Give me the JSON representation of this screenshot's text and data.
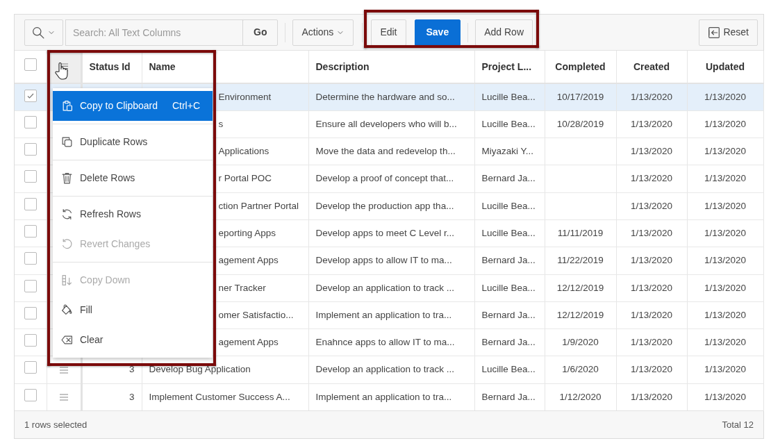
{
  "select_all": {
    "checked": false
  },
  "toolbar": {
    "search_placeholder": "Search: All Text Columns",
    "go": "Go",
    "actions": "Actions",
    "edit": "Edit",
    "save": "Save",
    "add_row": "Add Row",
    "reset": "Reset"
  },
  "table": {
    "columns": [
      "Status Id",
      "Name",
      "Description",
      "Project L...",
      "Completed",
      "Created",
      "Updated"
    ],
    "rows": [
      {
        "selected": true,
        "under_menu": true,
        "name": "Environment",
        "description": "Determine the hardware and so...",
        "project_lead": "Lucille Bea...",
        "completed": "10/17/2019",
        "created": "1/13/2020",
        "updated": "1/13/2020"
      },
      {
        "selected": false,
        "under_menu": true,
        "name": "s",
        "description": "Ensure all developers who will b...",
        "project_lead": "Lucille Bea...",
        "completed": "10/28/2019",
        "created": "1/13/2020",
        "updated": "1/13/2020"
      },
      {
        "selected": false,
        "under_menu": true,
        "name": "Applications",
        "description": "Move the data and redevelop th...",
        "project_lead": "Miyazaki Y...",
        "created": "1/13/2020",
        "updated": "1/13/2020"
      },
      {
        "selected": false,
        "under_menu": true,
        "name": "r Portal POC",
        "description": "Develop a proof of concept that...",
        "project_lead": "Bernard Ja...",
        "created": "1/13/2020",
        "updated": "1/13/2020"
      },
      {
        "selected": false,
        "under_menu": true,
        "name": "ction Partner Portal",
        "description": "Develop the production app tha...",
        "project_lead": "Lucille Bea...",
        "created": "1/13/2020",
        "updated": "1/13/2020"
      },
      {
        "selected": false,
        "under_menu": true,
        "name": "eporting Apps",
        "description": "Develop apps to meet C Level r...",
        "project_lead": "Lucille Bea...",
        "completed": "11/11/2019",
        "created": "1/13/2020",
        "updated": "1/13/2020"
      },
      {
        "selected": false,
        "under_menu": true,
        "name": "agement Apps",
        "description": "Develop apps to allow IT to ma...",
        "project_lead": "Bernard Ja...",
        "completed": "11/22/2019",
        "created": "1/13/2020",
        "updated": "1/13/2020"
      },
      {
        "selected": false,
        "under_menu": true,
        "name": "ner Tracker",
        "description": "Develop an application to track ...",
        "project_lead": "Lucille Bea...",
        "completed": "12/12/2019",
        "created": "1/13/2020",
        "updated": "1/13/2020"
      },
      {
        "selected": false,
        "under_menu": true,
        "name": "omer Satisfactio...",
        "description": "Implement an application to tra...",
        "project_lead": "Bernard Ja...",
        "completed": "12/12/2019",
        "created": "1/13/2020",
        "updated": "1/13/2020"
      },
      {
        "selected": false,
        "under_menu": true,
        "name": "agement Apps",
        "description": "Enahnce apps to allow IT to ma...",
        "project_lead": "Bernard Ja...",
        "completed": "1/9/2020",
        "created": "1/13/2020",
        "updated": "1/13/2020"
      },
      {
        "selected": false,
        "under_menu": false,
        "status_id": "3",
        "name": "Develop Bug Application",
        "description": "Develop an application to track ...",
        "project_lead": "Lucille Bea...",
        "completed": "1/6/2020",
        "created": "1/13/2020",
        "updated": "1/13/2020"
      },
      {
        "selected": false,
        "under_menu": false,
        "status_id": "3",
        "name": "Implement Customer Success A...",
        "description": "Implement an application to tra...",
        "project_lead": "Bernard Ja...",
        "completed": "1/12/2020",
        "created": "1/13/2020",
        "updated": "1/13/2020"
      }
    ]
  },
  "row_menu": {
    "groups": [
      [
        {
          "kind": "copy",
          "label": "Copy to Clipboard",
          "shortcut": "Ctrl+C",
          "selected": true,
          "disabled": false
        }
      ],
      [
        {
          "kind": "duplicate",
          "label": "Duplicate Rows",
          "selected": false,
          "disabled": false
        }
      ],
      [
        {
          "kind": "delete",
          "label": "Delete Rows",
          "selected": false,
          "disabled": false
        }
      ],
      [
        {
          "kind": "refresh",
          "label": "Refresh Rows",
          "selected": false,
          "disabled": false
        },
        {
          "kind": "revert",
          "label": "Revert Changes",
          "selected": false,
          "disabled": true
        }
      ],
      [
        {
          "kind": "copy_down",
          "label": "Copy Down",
          "selected": false,
          "disabled": true
        },
        {
          "kind": "fill",
          "label": "Fill",
          "selected": false,
          "disabled": false
        },
        {
          "kind": "clear",
          "label": "Clear",
          "selected": false,
          "disabled": false
        }
      ]
    ]
  },
  "footer": {
    "status": "1 rows selected",
    "total": "Total 12"
  }
}
